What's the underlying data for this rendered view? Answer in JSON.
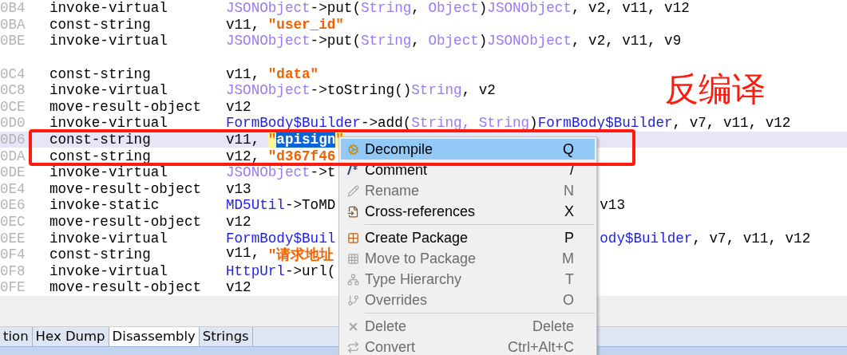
{
  "code_lines": [
    {
      "kind": "code",
      "address": "0B4",
      "opcode": "invoke-virtual",
      "highlighted": false,
      "operands": [
        {
          "text": "JSONObject",
          "kind": "type"
        },
        {
          "text": "->put(",
          "kind": "plain"
        },
        {
          "text": "String",
          "kind": "type"
        },
        {
          "text": ", ",
          "kind": "plain"
        },
        {
          "text": "Object",
          "kind": "type"
        },
        {
          "text": ")",
          "kind": "plain"
        },
        {
          "text": "JSONObject",
          "kind": "type"
        },
        {
          "text": ", v2, v11, v12",
          "kind": "plain"
        }
      ]
    },
    {
      "kind": "code",
      "address": "0BA",
      "opcode": "const-string",
      "highlighted": false,
      "operands": [
        {
          "text": "v11, ",
          "kind": "plain"
        },
        {
          "text": "\"user_id\"",
          "kind": "string"
        }
      ]
    },
    {
      "kind": "code",
      "address": "0BE",
      "opcode": "invoke-virtual",
      "highlighted": false,
      "operands": [
        {
          "text": "JSONObject",
          "kind": "type"
        },
        {
          "text": "->put(",
          "kind": "plain"
        },
        {
          "text": "String",
          "kind": "type"
        },
        {
          "text": ", ",
          "kind": "plain"
        },
        {
          "text": "Object",
          "kind": "type"
        },
        {
          "text": ")",
          "kind": "plain"
        },
        {
          "text": "JSONObject",
          "kind": "type"
        },
        {
          "text": ", v2, v11, v9",
          "kind": "plain"
        }
      ]
    },
    {
      "kind": "blank"
    },
    {
      "kind": "code",
      "address": "0C4",
      "opcode": "const-string",
      "highlighted": false,
      "operands": [
        {
          "text": "v11, ",
          "kind": "plain"
        },
        {
          "text": "\"data\"",
          "kind": "string"
        }
      ]
    },
    {
      "kind": "code",
      "address": "0C8",
      "opcode": "invoke-virtual",
      "highlighted": false,
      "operands": [
        {
          "text": "JSONObject",
          "kind": "type"
        },
        {
          "text": "->toString()",
          "kind": "plain"
        },
        {
          "text": "String",
          "kind": "type"
        },
        {
          "text": ", v2",
          "kind": "plain"
        }
      ]
    },
    {
      "kind": "code",
      "address": "0CE",
      "opcode": "move-result-object",
      "highlighted": false,
      "operands": [
        {
          "text": "v12",
          "kind": "plain"
        }
      ]
    },
    {
      "kind": "code",
      "address": "0D0",
      "opcode": "invoke-virtual",
      "highlighted": false,
      "operands": [
        {
          "text": "FormBody$Builder",
          "kind": "ref"
        },
        {
          "text": "->add(",
          "kind": "plain"
        },
        {
          "text": "String, String",
          "kind": "type"
        },
        {
          "text": ")",
          "kind": "plain"
        },
        {
          "text": "FormBody$Builder",
          "kind": "ref"
        },
        {
          "text": ", v7, v11, v12",
          "kind": "plain"
        }
      ]
    },
    {
      "kind": "code",
      "address": "0D6",
      "opcode": "const-string",
      "highlighted": true,
      "operands": [
        {
          "text": "v11, ",
          "kind": "plain"
        },
        {
          "text": "\"",
          "kind": "match"
        },
        {
          "text": "apisign",
          "kind": "selected"
        },
        {
          "text": "\"",
          "kind": "match"
        }
      ]
    },
    {
      "kind": "code",
      "address": "0DA",
      "opcode": "const-string",
      "highlighted": false,
      "operands": [
        {
          "text": "v12, ",
          "kind": "plain"
        },
        {
          "text": "\"d367f46",
          "kind": "string"
        }
      ]
    },
    {
      "kind": "code",
      "address": "0DE",
      "opcode": "invoke-virtual",
      "highlighted": false,
      "operands": [
        {
          "text": "JSONObject",
          "kind": "type"
        },
        {
          "text": "->t",
          "kind": "plain"
        }
      ]
    },
    {
      "kind": "code",
      "address": "0E4",
      "opcode": "move-result-object",
      "highlighted": false,
      "operands": [
        {
          "text": "v13",
          "kind": "plain"
        }
      ]
    },
    {
      "kind": "code",
      "address": "0E6",
      "opcode": "invoke-static",
      "highlighted": false,
      "operands": [
        {
          "text": "MD5Util",
          "kind": "ref"
        },
        {
          "text": "->ToMD",
          "kind": "plain"
        }
      ],
      "operands_right": [
        {
          "text": "v13",
          "kind": "plain"
        }
      ]
    },
    {
      "kind": "code",
      "address": "0EC",
      "opcode": "move-result-object",
      "highlighted": false,
      "operands": [
        {
          "text": "v12",
          "kind": "plain"
        }
      ]
    },
    {
      "kind": "code",
      "address": "0EE",
      "opcode": "invoke-virtual",
      "highlighted": false,
      "operands": [
        {
          "text": "FormBody$Buil",
          "kind": "ref"
        }
      ],
      "operands_right": [
        {
          "text": "ody$Builder",
          "kind": "ref"
        },
        {
          "text": ", v7, v11, v12",
          "kind": "plain"
        }
      ]
    },
    {
      "kind": "code",
      "address": "0F4",
      "opcode": "const-string",
      "highlighted": false,
      "operands": [
        {
          "text": "v11, ",
          "kind": "plain"
        },
        {
          "text": "\"请求地址",
          "kind": "string"
        }
      ]
    },
    {
      "kind": "code",
      "address": "0F8",
      "opcode": "invoke-virtual",
      "highlighted": false,
      "operands": [
        {
          "text": "HttpUrl",
          "kind": "ref"
        },
        {
          "text": "->url(",
          "kind": "plain"
        }
      ]
    },
    {
      "kind": "code",
      "address": "0FE",
      "opcode": "move-result-object",
      "highlighted": false,
      "operands": [
        {
          "text": "v12",
          "kind": "plain"
        }
      ]
    }
  ],
  "annotation": {
    "text": "反编译"
  },
  "context_menu": [
    {
      "kind": "item",
      "label": "Decompile",
      "shortcut": "Q",
      "disabled": false,
      "selected": true
    },
    {
      "kind": "item",
      "label": "Comment",
      "shortcut": "/",
      "disabled": false,
      "selected": false
    },
    {
      "kind": "item",
      "label": "Rename",
      "shortcut": "N",
      "disabled": true,
      "selected": false
    },
    {
      "kind": "item",
      "label": "Cross-references",
      "shortcut": "X",
      "disabled": false,
      "selected": false
    },
    {
      "kind": "separator"
    },
    {
      "kind": "item",
      "label": "Create Package",
      "shortcut": "P",
      "disabled": false,
      "selected": false
    },
    {
      "kind": "item",
      "label": "Move to Package",
      "shortcut": "M",
      "disabled": true,
      "selected": false
    },
    {
      "kind": "item",
      "label": "Type Hierarchy",
      "shortcut": "T",
      "disabled": true,
      "selected": false
    },
    {
      "kind": "item",
      "label": "Overrides",
      "shortcut": "O",
      "disabled": true,
      "selected": false
    },
    {
      "kind": "separator"
    },
    {
      "kind": "item",
      "label": "Delete",
      "shortcut": "Delete",
      "disabled": true,
      "selected": false
    },
    {
      "kind": "item",
      "label": "Convert",
      "shortcut": "Ctrl+Alt+C",
      "disabled": true,
      "selected": false
    }
  ],
  "tabs": [
    {
      "label": "tion",
      "selected": false
    },
    {
      "label": "Hex Dump",
      "selected": false
    },
    {
      "label": "Disassembly",
      "selected": true
    },
    {
      "label": "Strings",
      "selected": false
    }
  ]
}
